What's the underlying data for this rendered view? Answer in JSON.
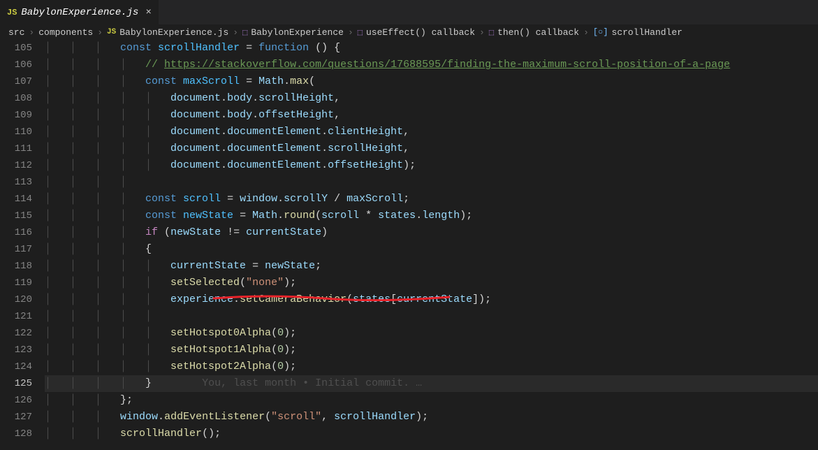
{
  "tab": {
    "icon": "JS",
    "label": "BabylonExperience.js",
    "close": "×"
  },
  "crumbs": {
    "c0": "src",
    "c1": "components",
    "c2_icon": "JS",
    "c2": "BabylonExperience.js",
    "c3": "BabylonExperience",
    "c4": "useEffect() callback",
    "c5": "then() callback",
    "c6": "scrollHandler"
  },
  "lines": {
    "105": "105",
    "106": "106",
    "107": "107",
    "108": "108",
    "109": "109",
    "110": "110",
    "111": "111",
    "112": "112",
    "113": "113",
    "114": "114",
    "115": "115",
    "116": "116",
    "117": "117",
    "118": "118",
    "119": "119",
    "120": "120",
    "121": "121",
    "122": "122",
    "123": "123",
    "124": "124",
    "125": "125",
    "126": "126",
    "127": "127",
    "128": "128"
  },
  "code": {
    "l105": {
      "a": "const ",
      "b": "scrollHandler",
      "c": " = ",
      "d": "function",
      "e": " () {"
    },
    "l106": {
      "a": "// ",
      "b": "https://stackoverflow.com/questions/17688595/finding-the-maximum-scroll-position-of-a-page"
    },
    "l107": {
      "a": "const ",
      "b": "maxScroll",
      "c": " = ",
      "d": "Math",
      "e": ".",
      "f": "max",
      "g": "("
    },
    "l108": {
      "a": "document",
      "b": ".",
      "c": "body",
      "d": ".",
      "e": "scrollHeight",
      "f": ","
    },
    "l109": {
      "a": "document",
      "b": ".",
      "c": "body",
      "d": ".",
      "e": "offsetHeight",
      "f": ","
    },
    "l110": {
      "a": "document",
      "b": ".",
      "c": "documentElement",
      "d": ".",
      "e": "clientHeight",
      "f": ","
    },
    "l111": {
      "a": "document",
      "b": ".",
      "c": "documentElement",
      "d": ".",
      "e": "scrollHeight",
      "f": ","
    },
    "l112": {
      "a": "document",
      "b": ".",
      "c": "documentElement",
      "d": ".",
      "e": "offsetHeight",
      "f": ");"
    },
    "l114": {
      "a": "const ",
      "b": "scroll",
      "c": " = ",
      "d": "window",
      "e": ".",
      "f": "scrollY",
      "g": " / ",
      "h": "maxScroll",
      "i": ";"
    },
    "l115": {
      "a": "const ",
      "b": "newState",
      "c": " = ",
      "d": "Math",
      "e": ".",
      "f": "round",
      "g": "(",
      "h": "scroll",
      "i": " * ",
      "j": "states",
      "k": ".",
      "l": "length",
      "m": ");"
    },
    "l116": {
      "a": "if ",
      "b": "(",
      "c": "newState",
      "d": " != ",
      "e": "currentState",
      "f": ")"
    },
    "l117": {
      "a": "{"
    },
    "l118": {
      "a": "currentState",
      "b": " = ",
      "c": "newState",
      "d": ";"
    },
    "l119": {
      "a": "setSelected",
      "b": "(",
      "c": "\"none\"",
      "d": ");"
    },
    "l120": {
      "a": "experience",
      "b": ".",
      "c": "setCameraBehavior",
      "d": "(",
      "e": "states",
      "f": "[",
      "g": "currentState",
      "h": "]);"
    },
    "l122": {
      "a": "setHotspot0Alpha",
      "b": "(",
      "c": "0",
      "d": ");"
    },
    "l123": {
      "a": "setHotspot1Alpha",
      "b": "(",
      "c": "0",
      "d": ");"
    },
    "l124": {
      "a": "setHotspot2Alpha",
      "b": "(",
      "c": "0",
      "d": ");"
    },
    "l125": {
      "a": "}",
      "blame": "You, last month • Initial commit. …"
    },
    "l126": {
      "a": "};"
    },
    "l127": {
      "a": "window",
      "b": ".",
      "c": "addEventListener",
      "d": "(",
      "e": "\"scroll\"",
      "f": ", ",
      "g": "scrollHandler",
      "h": ");"
    },
    "l128": {
      "a": "scrollHandler",
      "b": "();"
    }
  },
  "indent": {
    "i1": "            ",
    "i2": "                ",
    "i3": "                    ",
    "i4": "                        "
  },
  "guides": {
    "g3": "│   │   │   ",
    "g4": "│   │   │   │   ",
    "g5": "│   │   │   │   │   "
  }
}
